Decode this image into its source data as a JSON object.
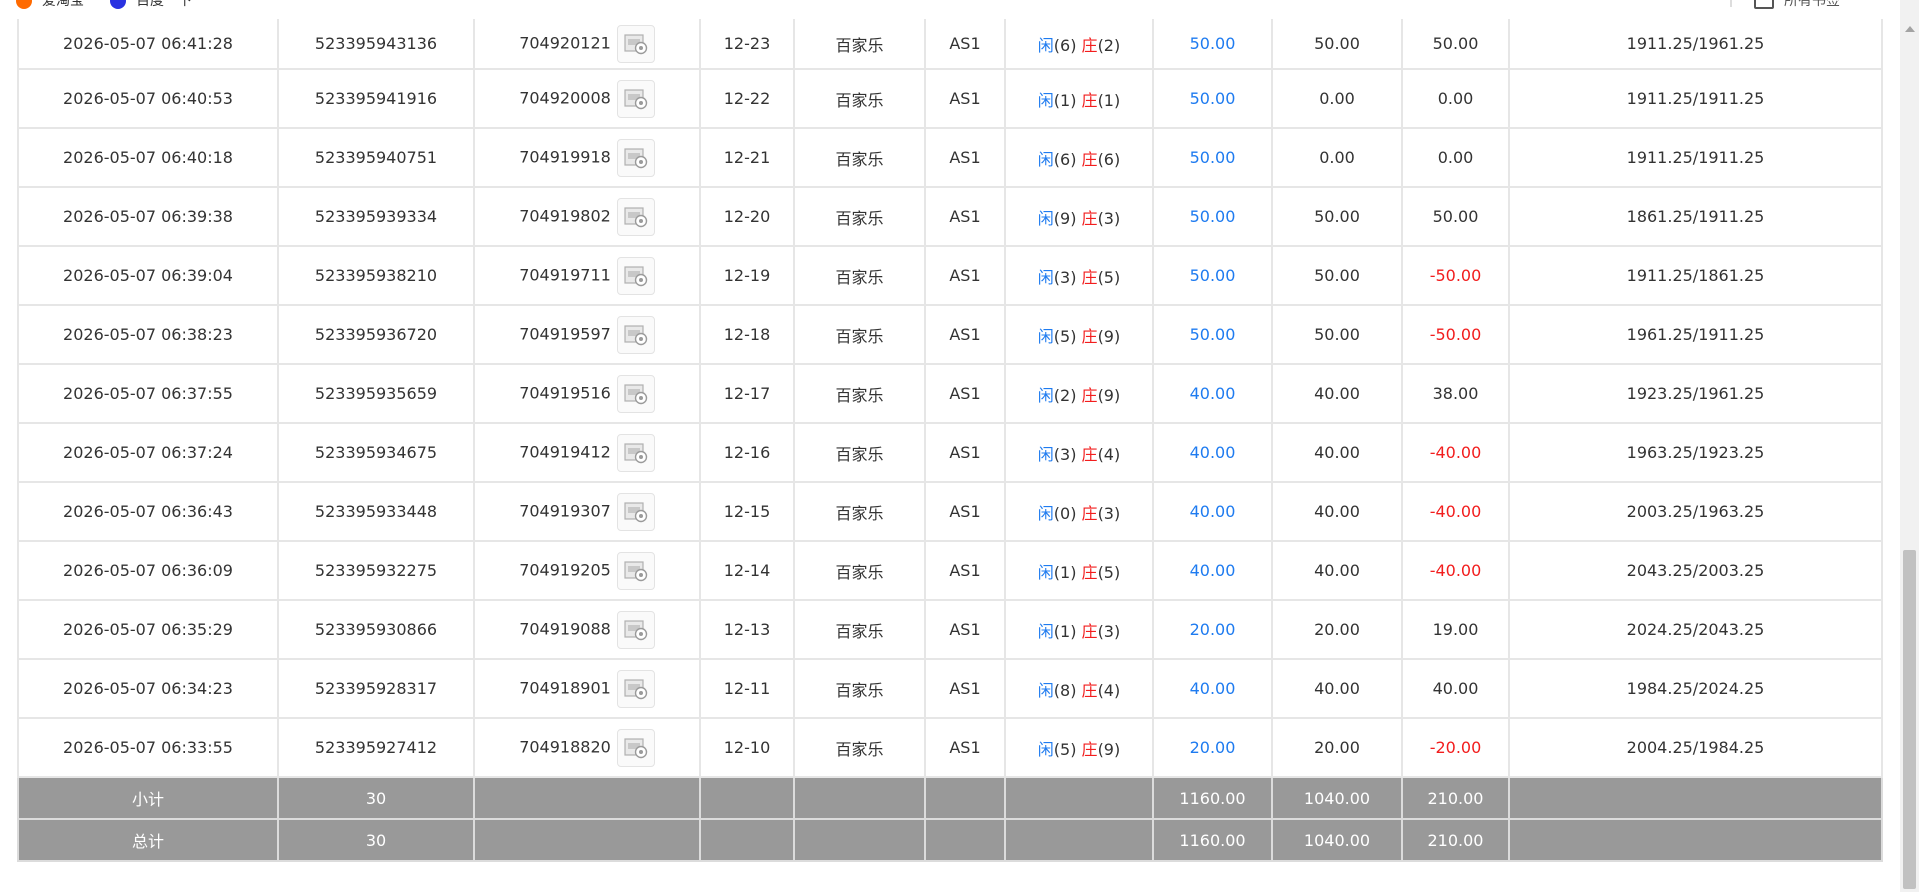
{
  "bookmarks": [
    {
      "label": "爱淘宝",
      "icon": "taobao-icon",
      "color": "#ff6a00"
    },
    {
      "label": "百度一下",
      "icon": "baidu-icon",
      "color": "#2932e1"
    }
  ],
  "bookmarks_right": {
    "label": "所有书签",
    "icon": "folder-icon"
  },
  "game_name": "百家乐",
  "table_code": "AS1",
  "xian_label": "闲",
  "zhuang_label": "庄",
  "rows": [
    {
      "time": "2026-05-07 06:41:28",
      "bet_id": "523395943136",
      "round_id": "704920121",
      "shoe": "12-23",
      "game": "百家乐",
      "table": "AS1",
      "xian": "(6)",
      "zhuang": "(2)",
      "bet": "50.00",
      "valid": "50.00",
      "win": "50.00",
      "win_neg": false,
      "balance": "1911.25/1961.25"
    },
    {
      "time": "2026-05-07 06:40:53",
      "bet_id": "523395941916",
      "round_id": "704920008",
      "shoe": "12-22",
      "game": "百家乐",
      "table": "AS1",
      "xian": "(1)",
      "zhuang": "(1)",
      "bet": "50.00",
      "valid": "0.00",
      "win": "0.00",
      "win_neg": false,
      "balance": "1911.25/1911.25"
    },
    {
      "time": "2026-05-07 06:40:18",
      "bet_id": "523395940751",
      "round_id": "704919918",
      "shoe": "12-21",
      "game": "百家乐",
      "table": "AS1",
      "xian": "(6)",
      "zhuang": "(6)",
      "bet": "50.00",
      "valid": "0.00",
      "win": "0.00",
      "win_neg": false,
      "balance": "1911.25/1911.25"
    },
    {
      "time": "2026-05-07 06:39:38",
      "bet_id": "523395939334",
      "round_id": "704919802",
      "shoe": "12-20",
      "game": "百家乐",
      "table": "AS1",
      "xian": "(9)",
      "zhuang": "(3)",
      "bet": "50.00",
      "valid": "50.00",
      "win": "50.00",
      "win_neg": false,
      "balance": "1861.25/1911.25"
    },
    {
      "time": "2026-05-07 06:39:04",
      "bet_id": "523395938210",
      "round_id": "704919711",
      "shoe": "12-19",
      "game": "百家乐",
      "table": "AS1",
      "xian": "(3)",
      "zhuang": "(5)",
      "bet": "50.00",
      "valid": "50.00",
      "win": "-50.00",
      "win_neg": true,
      "balance": "1911.25/1861.25"
    },
    {
      "time": "2026-05-07 06:38:23",
      "bet_id": "523395936720",
      "round_id": "704919597",
      "shoe": "12-18",
      "game": "百家乐",
      "table": "AS1",
      "xian": "(5)",
      "zhuang": "(9)",
      "bet": "50.00",
      "valid": "50.00",
      "win": "-50.00",
      "win_neg": true,
      "balance": "1961.25/1911.25"
    },
    {
      "time": "2026-05-07 06:37:55",
      "bet_id": "523395935659",
      "round_id": "704919516",
      "shoe": "12-17",
      "game": "百家乐",
      "table": "AS1",
      "xian": "(2)",
      "zhuang": "(9)",
      "bet": "40.00",
      "valid": "40.00",
      "win": "38.00",
      "win_neg": false,
      "balance": "1923.25/1961.25"
    },
    {
      "time": "2026-05-07 06:37:24",
      "bet_id": "523395934675",
      "round_id": "704919412",
      "shoe": "12-16",
      "game": "百家乐",
      "table": "AS1",
      "xian": "(3)",
      "zhuang": "(4)",
      "bet": "40.00",
      "valid": "40.00",
      "win": "-40.00",
      "win_neg": true,
      "balance": "1963.25/1923.25"
    },
    {
      "time": "2026-05-07 06:36:43",
      "bet_id": "523395933448",
      "round_id": "704919307",
      "shoe": "12-15",
      "game": "百家乐",
      "table": "AS1",
      "xian": "(0)",
      "zhuang": "(3)",
      "bet": "40.00",
      "valid": "40.00",
      "win": "-40.00",
      "win_neg": true,
      "balance": "2003.25/1963.25"
    },
    {
      "time": "2026-05-07 06:36:09",
      "bet_id": "523395932275",
      "round_id": "704919205",
      "shoe": "12-14",
      "game": "百家乐",
      "table": "AS1",
      "xian": "(1)",
      "zhuang": "(5)",
      "bet": "40.00",
      "valid": "40.00",
      "win": "-40.00",
      "win_neg": true,
      "balance": "2043.25/2003.25"
    },
    {
      "time": "2026-05-07 06:35:29",
      "bet_id": "523395930866",
      "round_id": "704919088",
      "shoe": "12-13",
      "game": "百家乐",
      "table": "AS1",
      "xian": "(1)",
      "zhuang": "(3)",
      "bet": "20.00",
      "valid": "20.00",
      "win": "19.00",
      "win_neg": false,
      "balance": "2024.25/2043.25"
    },
    {
      "time": "2026-05-07 06:34:23",
      "bet_id": "523395928317",
      "round_id": "704918901",
      "shoe": "12-11",
      "game": "百家乐",
      "table": "AS1",
      "xian": "(8)",
      "zhuang": "(4)",
      "bet": "40.00",
      "valid": "40.00",
      "win": "40.00",
      "win_neg": false,
      "balance": "1984.25/2024.25"
    },
    {
      "time": "2026-05-07 06:33:55",
      "bet_id": "523395927412",
      "round_id": "704918820",
      "shoe": "12-10",
      "game": "百家乐",
      "table": "AS1",
      "xian": "(5)",
      "zhuang": "(9)",
      "bet": "20.00",
      "valid": "20.00",
      "win": "-20.00",
      "win_neg": true,
      "balance": "2004.25/1984.25"
    }
  ],
  "subtotal": {
    "label": "小计",
    "count": "30",
    "bet": "1160.00",
    "valid": "1040.00",
    "win": "210.00"
  },
  "total": {
    "label": "总计",
    "count": "30",
    "bet": "1160.00",
    "valid": "1040.00",
    "win": "210.00"
  },
  "colors": {
    "blue": "#1e7bf0",
    "red": "#f21d1d",
    "summary_bg": "#999999"
  }
}
